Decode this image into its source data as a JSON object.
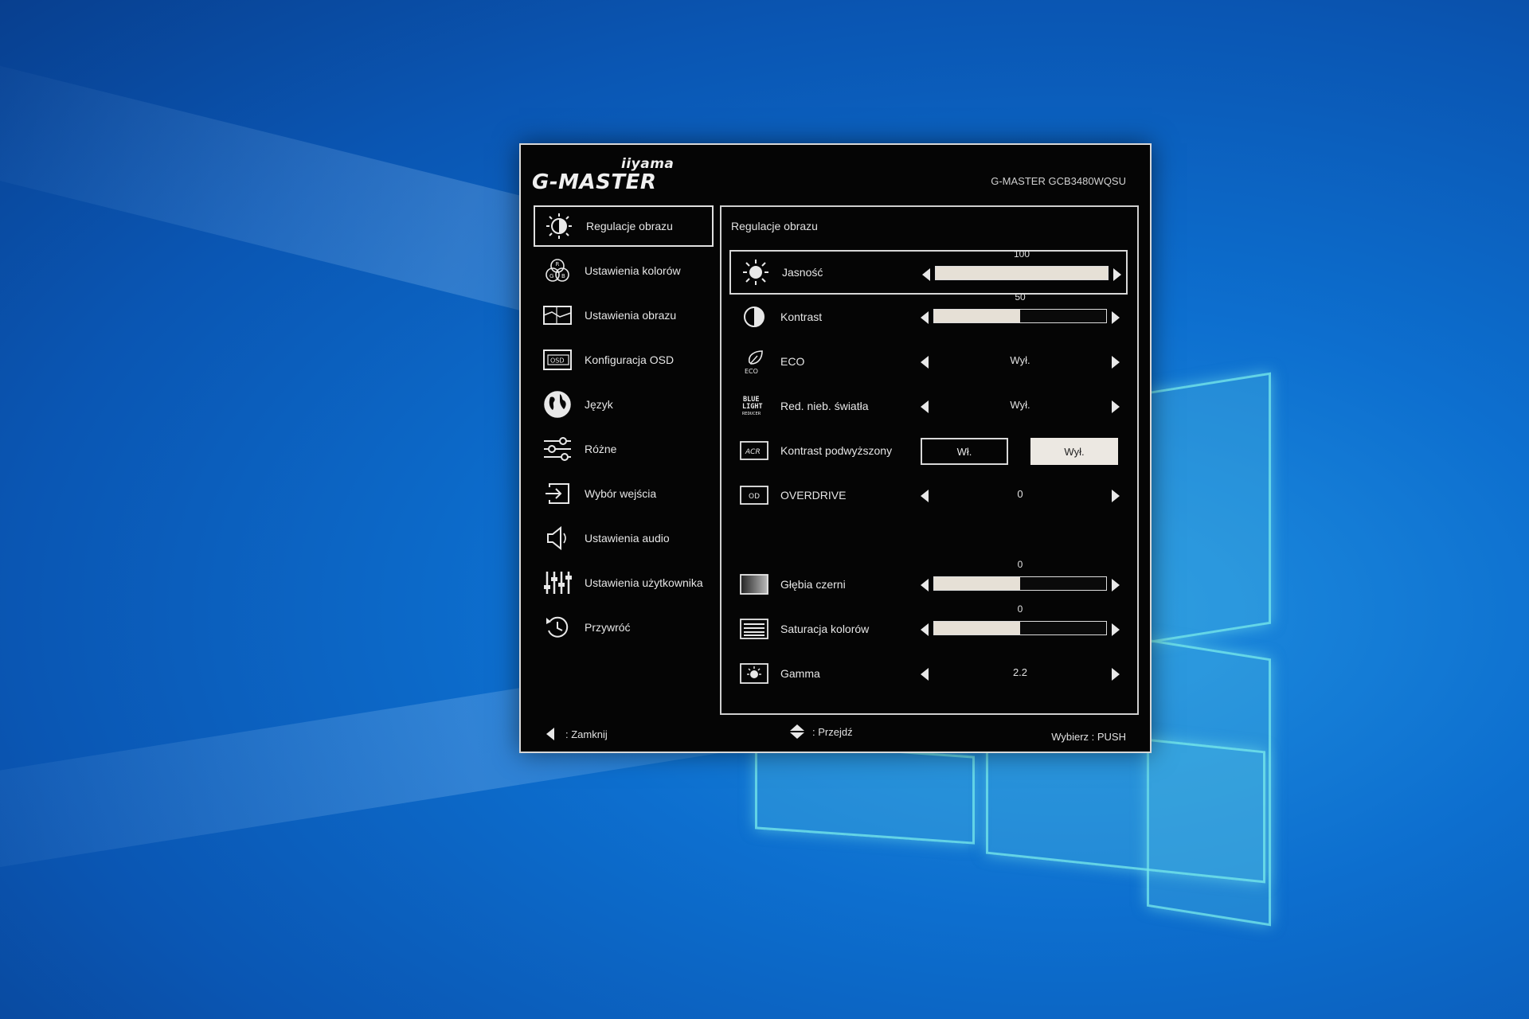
{
  "brand": {
    "vendor": "iiyama",
    "product": "G-MASTER",
    "model": "G-MASTER  GCB3480WQSU"
  },
  "sidebar": {
    "items": [
      {
        "label": "Regulacje obrazu",
        "icon": "brightness-icon",
        "active": true
      },
      {
        "label": "Ustawienia kolorów",
        "icon": "rgb-circles-icon"
      },
      {
        "label": "Ustawienia obrazu",
        "icon": "picture-frame-icon"
      },
      {
        "label": "Konfiguracja OSD",
        "icon": "osd-icon"
      },
      {
        "label": "Język",
        "icon": "globe-icon"
      },
      {
        "label": "Różne",
        "icon": "sliders-icon"
      },
      {
        "label": "Wybór wejścia",
        "icon": "input-icon"
      },
      {
        "label": "Ustawienia audio",
        "icon": "speaker-icon"
      },
      {
        "label": "Ustawienia użytkownika",
        "icon": "equalizer-icon"
      },
      {
        "label": "Przywróć",
        "icon": "reset-icon"
      }
    ]
  },
  "panel": {
    "title": "Regulacje obrazu",
    "rows": [
      {
        "label": "Jasność",
        "icon": "sun-icon",
        "type": "bar",
        "value": "100",
        "level": 1.0,
        "selected": true
      },
      {
        "label": "Kontrast",
        "icon": "contrast-icon",
        "type": "bar",
        "value": "50",
        "level": 0.5
      },
      {
        "label": "ECO",
        "icon": "eco-leaf-icon",
        "type": "value",
        "value": "Wył."
      },
      {
        "label": "Red. nieb. światła",
        "icon": "blue-light-icon",
        "type": "value",
        "value": "Wył."
      },
      {
        "label": "Kontrast podwyższony",
        "icon": "acr-icon",
        "type": "toggle",
        "option_on": "Wł.",
        "option_off": "Wył.",
        "value": "Wył."
      },
      {
        "label": "OVERDRIVE",
        "icon": "od-icon",
        "type": "value",
        "value": "0"
      },
      {
        "label": "Głębia czerni",
        "icon": "black-level-icon",
        "type": "bar",
        "value": "0",
        "level": 0.5
      },
      {
        "label": "Saturacja kolorów",
        "icon": "saturation-icon",
        "type": "bar",
        "value": "0",
        "level": 0.5
      },
      {
        "label": "Gamma",
        "icon": "gamma-icon",
        "type": "value",
        "value": "2.2"
      }
    ]
  },
  "footer": {
    "close": ": Zamknij",
    "navigate": ": Przejdź",
    "select": "Wybierz : PUSH"
  }
}
